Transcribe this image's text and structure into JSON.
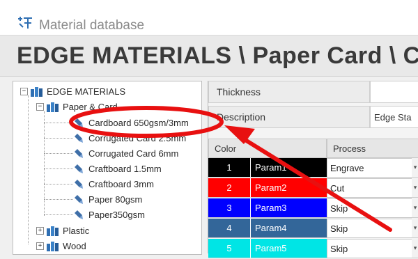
{
  "window": {
    "title": "Material database",
    "icon": "material-database-icon"
  },
  "header": {
    "path": "EDGE MATERIALS \\ Paper  Card \\ C"
  },
  "tree": {
    "root": {
      "label": "EDGE MATERIALS",
      "expanded": true,
      "icon": "folder-books-icon"
    },
    "group": {
      "label": "Paper & Card",
      "expanded": true,
      "icon": "folder-books-icon"
    },
    "items": [
      {
        "label": "Cardboard 650gsm/3mm",
        "icon": "material-leaf-icon",
        "highlighted": true
      },
      {
        "label": "Corrugated Card 2.5mm",
        "icon": "material-leaf-icon"
      },
      {
        "label": "Corrugated Card 6mm",
        "icon": "material-leaf-icon"
      },
      {
        "label": "Craftboard 1.5mm",
        "icon": "material-leaf-icon"
      },
      {
        "label": "Craftboard 3mm",
        "icon": "material-leaf-icon"
      },
      {
        "label": "Paper 80gsm",
        "icon": "material-leaf-icon"
      },
      {
        "label": "Paper350gsm",
        "icon": "material-leaf-icon"
      }
    ],
    "collapsed": [
      {
        "label": "Plastic",
        "expanded": false,
        "icon": "folder-books-icon"
      },
      {
        "label": "Wood",
        "expanded": false,
        "icon": "folder-books-icon"
      }
    ]
  },
  "properties": {
    "thickness": {
      "label": "Thickness",
      "value": ""
    },
    "description": {
      "label": "Description",
      "value": "Edge Sta"
    }
  },
  "grid": {
    "headers": {
      "color": "Color",
      "process": "Process"
    },
    "rows": [
      {
        "num": "1",
        "param": "Param1",
        "process": "Engrave",
        "bg": "#000000"
      },
      {
        "num": "2",
        "param": "Param2",
        "process": "Cut",
        "bg": "#ff0000"
      },
      {
        "num": "3",
        "param": "Param3",
        "process": "Skip",
        "bg": "#0000ff"
      },
      {
        "num": "4",
        "param": "Param4",
        "process": "Skip",
        "bg": "#336699"
      },
      {
        "num": "5",
        "param": "Param5",
        "process": "Skip",
        "bg": "#00e5e5"
      }
    ]
  },
  "annotation": {
    "color": "#e81010",
    "shape": "ellipse-with-arrow"
  },
  "colors": {
    "window_bg": "#f0f0f0",
    "folder_blue": "#2f6fb3"
  }
}
